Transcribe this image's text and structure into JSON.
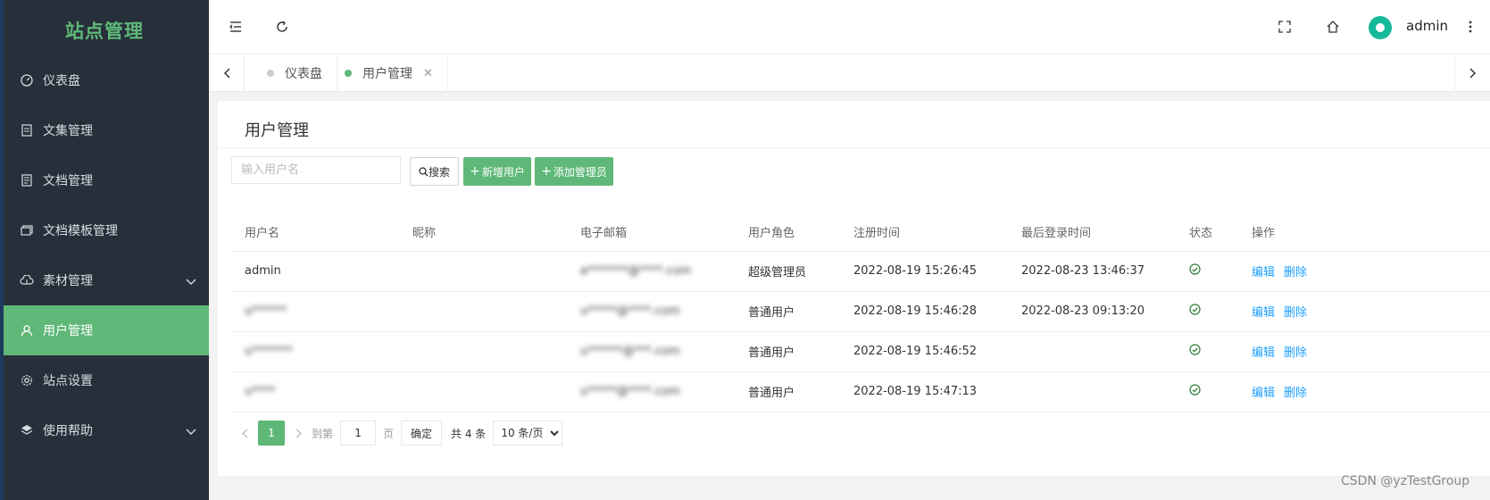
{
  "sidebar": {
    "brand": "站点管理",
    "items": [
      {
        "label": "仪表盘",
        "icon": "dashboard-icon"
      },
      {
        "label": "文集管理",
        "icon": "collection-icon"
      },
      {
        "label": "文档管理",
        "icon": "document-icon"
      },
      {
        "label": "文档模板管理",
        "icon": "template-icon"
      },
      {
        "label": "素材管理",
        "icon": "cloud-icon",
        "expandable": true
      },
      {
        "label": "用户管理",
        "icon": "user-icon",
        "active": true
      },
      {
        "label": "站点设置",
        "icon": "gear-icon"
      },
      {
        "label": "使用帮助",
        "icon": "layers-icon",
        "expandable": true
      }
    ]
  },
  "header": {
    "username": "admin"
  },
  "tabs": [
    {
      "label": "仪表盘",
      "active": false
    },
    {
      "label": "用户管理",
      "active": true,
      "close": "✕"
    }
  ],
  "page": {
    "title": "用户管理",
    "search_placeholder": "输入用户名",
    "search_label": "搜索",
    "add_user_label": "新增用户",
    "add_admin_label": "添加管理员"
  },
  "table": {
    "columns": [
      "用户名",
      "昵称",
      "电子邮箱",
      "用户角色",
      "注册时间",
      "最后登录时间",
      "状态",
      "操作"
    ],
    "edit_label": "编辑",
    "delete_label": "删除",
    "rows": [
      {
        "username": "admin",
        "nickname": "",
        "email": "a*******@****.com",
        "role": "超级管理员",
        "registered": "2022-08-19 15:26:45",
        "last_login": "2022-08-23 13:46:37",
        "status": "enabled"
      },
      {
        "username": "u******",
        "nickname": "",
        "email": "u*****@****.com",
        "role": "普通用户",
        "registered": "2022-08-19 15:46:28",
        "last_login": "2022-08-23 09:13:20",
        "status": "enabled"
      },
      {
        "username": "u*******",
        "nickname": "",
        "email": "u******@***.com",
        "role": "普通用户",
        "registered": "2022-08-19 15:46:52",
        "last_login": "",
        "status": "enabled"
      },
      {
        "username": "u****",
        "nickname": "",
        "email": "u*****@****.com",
        "role": "普通用户",
        "registered": "2022-08-19 15:47:13",
        "last_login": "",
        "status": "enabled"
      }
    ]
  },
  "pager": {
    "current_page": "1",
    "goto_label": "到第",
    "page_unit": "页",
    "page_input": "1",
    "confirm_label": "确定",
    "total_label": "共 4 条",
    "page_size": "10 条/页"
  },
  "colors": {
    "accent": "#5fb878",
    "sidebar_bg": "#262f3a",
    "link": "#1e9fff"
  },
  "watermark": "CSDN @yzTestGroup"
}
